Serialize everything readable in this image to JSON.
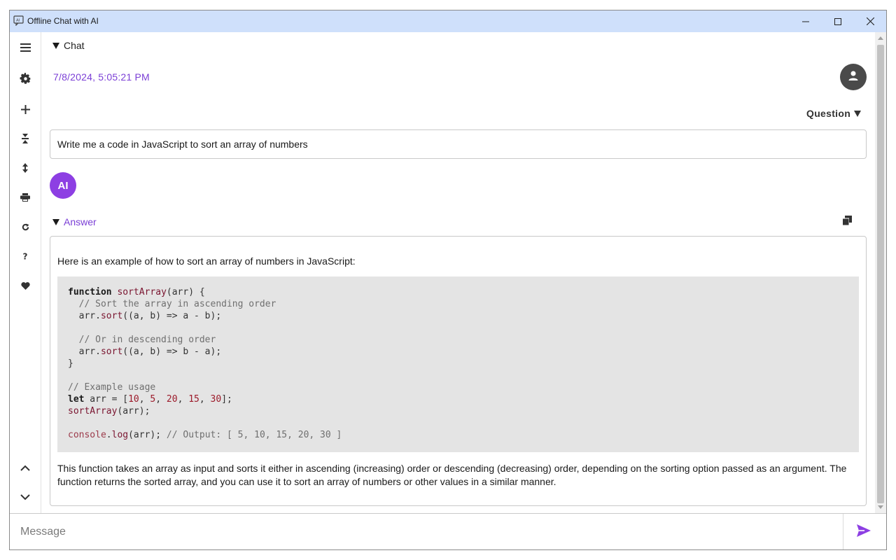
{
  "window": {
    "title": "Offline Chat with AI",
    "icon": "chat-ai-icon",
    "controls": [
      "minimize-icon",
      "maximize-icon",
      "close-icon"
    ]
  },
  "sidebar": {
    "items": [
      {
        "icon": "menu-icon"
      },
      {
        "icon": "gear-icon"
      },
      {
        "icon": "plus-icon"
      },
      {
        "icon": "collapse-icon"
      },
      {
        "icon": "expand-icon"
      },
      {
        "icon": "print-icon"
      },
      {
        "icon": "refresh-icon"
      },
      {
        "icon": "help-icon"
      },
      {
        "icon": "heart-icon"
      }
    ],
    "bottom": [
      {
        "icon": "chevron-up-icon"
      },
      {
        "icon": "chevron-down-icon"
      }
    ]
  },
  "chat": {
    "header": "Chat",
    "timestamp": "7/8/2024, 5:05:21 PM",
    "question_label": "Question",
    "question_text": "Write me a code in JavaScript to sort an array of numbers",
    "ai_avatar_label": "AI",
    "answer_label": "Answer",
    "answer_intro": "Here is an example of how to sort an array of numbers in JavaScript:",
    "code_lines": [
      "function sortArray(arr) {",
      "  // Sort the array in ascending order",
      "  arr.sort((a, b) => a - b);",
      "",
      "  // Or in descending order",
      "  arr.sort((a, b) => b - a);",
      "}",
      "",
      "// Example usage",
      "let arr = [10, 5, 20, 15, 30];",
      "sortArray(arr);",
      "",
      "console.log(arr); // Output: [ 5, 10, 15, 20, 30 ]"
    ],
    "answer_outro": "This function takes an array as input and sorts it either in ascending (increasing) order or descending (decreasing) order, depending on the sorting option passed as an argument. The function returns the sorted array, and you can use it to sort an array of numbers or other values in a similar manner."
  },
  "input": {
    "placeholder": "Message",
    "value": ""
  },
  "colors": {
    "accent": "#7b3fd6",
    "ai_avatar": "#8d3fe3",
    "titlebar": "#cfe0fb",
    "code_bg": "#e4e4e4"
  }
}
